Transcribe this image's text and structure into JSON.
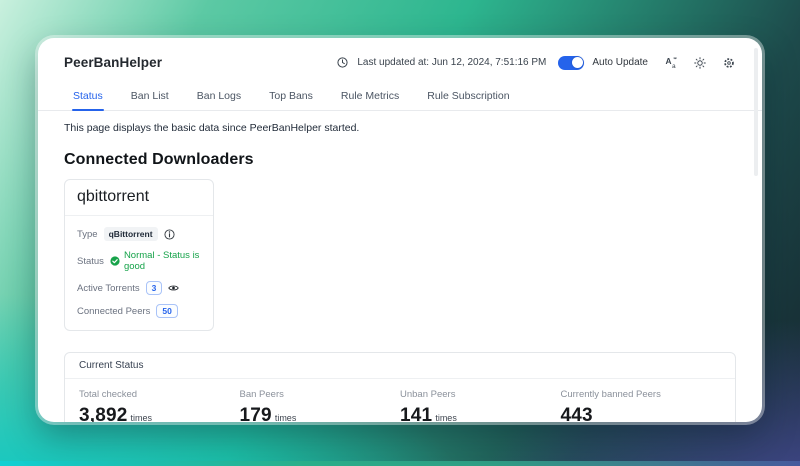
{
  "colors": {
    "accent_blue": "#2563eb",
    "success_green": "#16a34a",
    "bg_teal": "#00c9cc",
    "bg_indigo": "#4d52a6"
  },
  "header": {
    "app_title": "PeerBanHelper",
    "last_updated": "Last updated at: Jun 12, 2024, 7:51:16 PM",
    "auto_update_label": "Auto Update",
    "auto_update_on": true,
    "icons": {
      "clock": "clock-icon",
      "language": "language-switch-icon",
      "theme": "sun-icon",
      "settings": "gear-icon"
    }
  },
  "tabs": [
    {
      "label": "Status",
      "active": true
    },
    {
      "label": "Ban List",
      "active": false
    },
    {
      "label": "Ban Logs",
      "active": false
    },
    {
      "label": "Top Bans",
      "active": false
    },
    {
      "label": "Rule Metrics",
      "active": false
    },
    {
      "label": "Rule Subscription",
      "active": false
    }
  ],
  "page": {
    "description": "This page displays the basic data since PeerBanHelper started.",
    "section_title": "Connected Downloaders"
  },
  "downloader": {
    "title": "qbittorrent",
    "type_label": "Type",
    "type_value": "qBittorrent",
    "status_label": "Status",
    "status_value": "Normal - Status is good",
    "active_torrents_label": "Active Torrents",
    "active_torrents_value": "3",
    "connected_peers_label": "Connected Peers",
    "connected_peers_value": "50"
  },
  "current_status": {
    "title": "Current Status",
    "stats": [
      {
        "label": "Total checked",
        "value": "3,892",
        "suffix": "times"
      },
      {
        "label": "Ban Peers",
        "value": "179",
        "suffix": "times"
      },
      {
        "label": "Unban Peers",
        "value": "141",
        "suffix": "times"
      },
      {
        "label": "Currently banned Peers",
        "value": "443",
        "suffix": ""
      }
    ]
  }
}
